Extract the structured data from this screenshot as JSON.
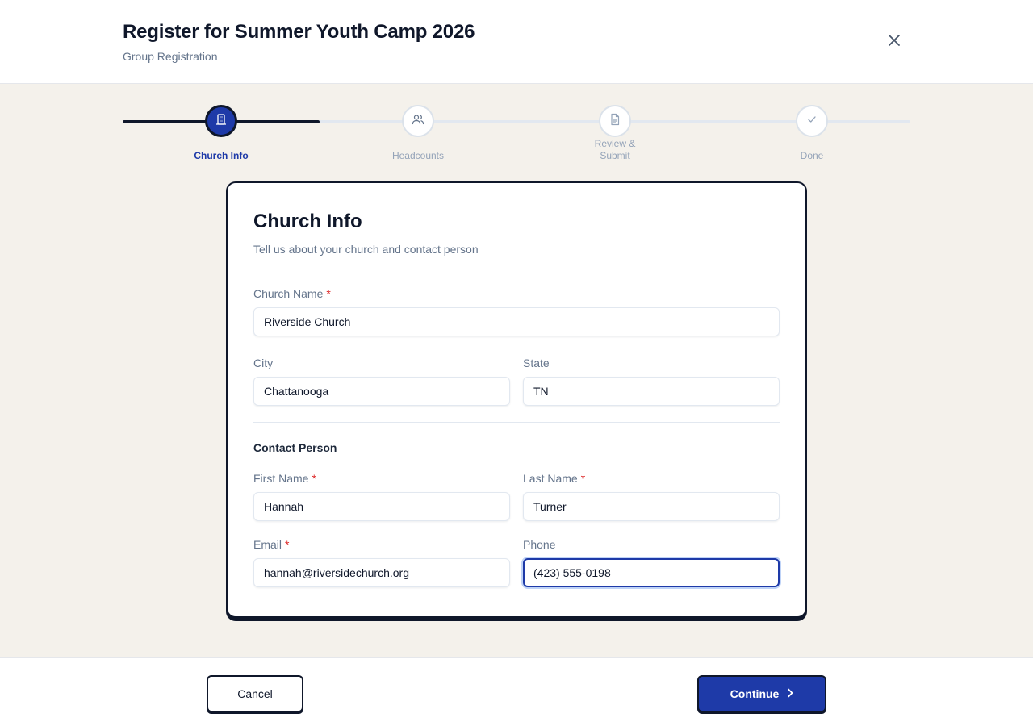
{
  "header": {
    "title": "Register for Summer Youth Camp 2026",
    "subtitle": "Group Registration",
    "close_icon": "close-icon"
  },
  "stepper": {
    "progress_fraction": 0.25,
    "steps": [
      {
        "label": "Church Info",
        "icon": "building-icon",
        "active": true
      },
      {
        "label": "Headcounts",
        "icon": "users-icon",
        "active": false
      },
      {
        "label_line1": "Review &",
        "label_line2": "Submit",
        "icon": "document-icon",
        "active": false
      },
      {
        "label": "Done",
        "icon": "check-icon",
        "active": false
      }
    ]
  },
  "card": {
    "title": "Church Info",
    "description": "Tell us about your church and contact person",
    "required_mark": "*",
    "church_name": {
      "label": "Church Name",
      "value": "Riverside Church",
      "required": true
    },
    "city": {
      "label": "City",
      "value": "Chattanooga",
      "required": false
    },
    "state": {
      "label": "State",
      "value": "TN",
      "required": false
    },
    "contact_section_title": "Contact Person",
    "first_name": {
      "label": "First Name",
      "value": "Hannah",
      "required": true
    },
    "last_name": {
      "label": "Last Name",
      "value": "Turner",
      "required": true
    },
    "email": {
      "label": "Email",
      "value": "hannah@riversidechurch.org",
      "required": true
    },
    "phone": {
      "label": "Phone",
      "value": "(423) 555-0198",
      "required": false,
      "focused": true
    }
  },
  "footer": {
    "cancel_label": "Cancel",
    "continue_label": "Continue",
    "continue_icon": "chevron-right-icon"
  },
  "colors": {
    "accent": "#1e3aa8",
    "ink": "#0f172a",
    "muted": "#64748b",
    "background": "#f4f1eb",
    "required": "#dc2626"
  }
}
